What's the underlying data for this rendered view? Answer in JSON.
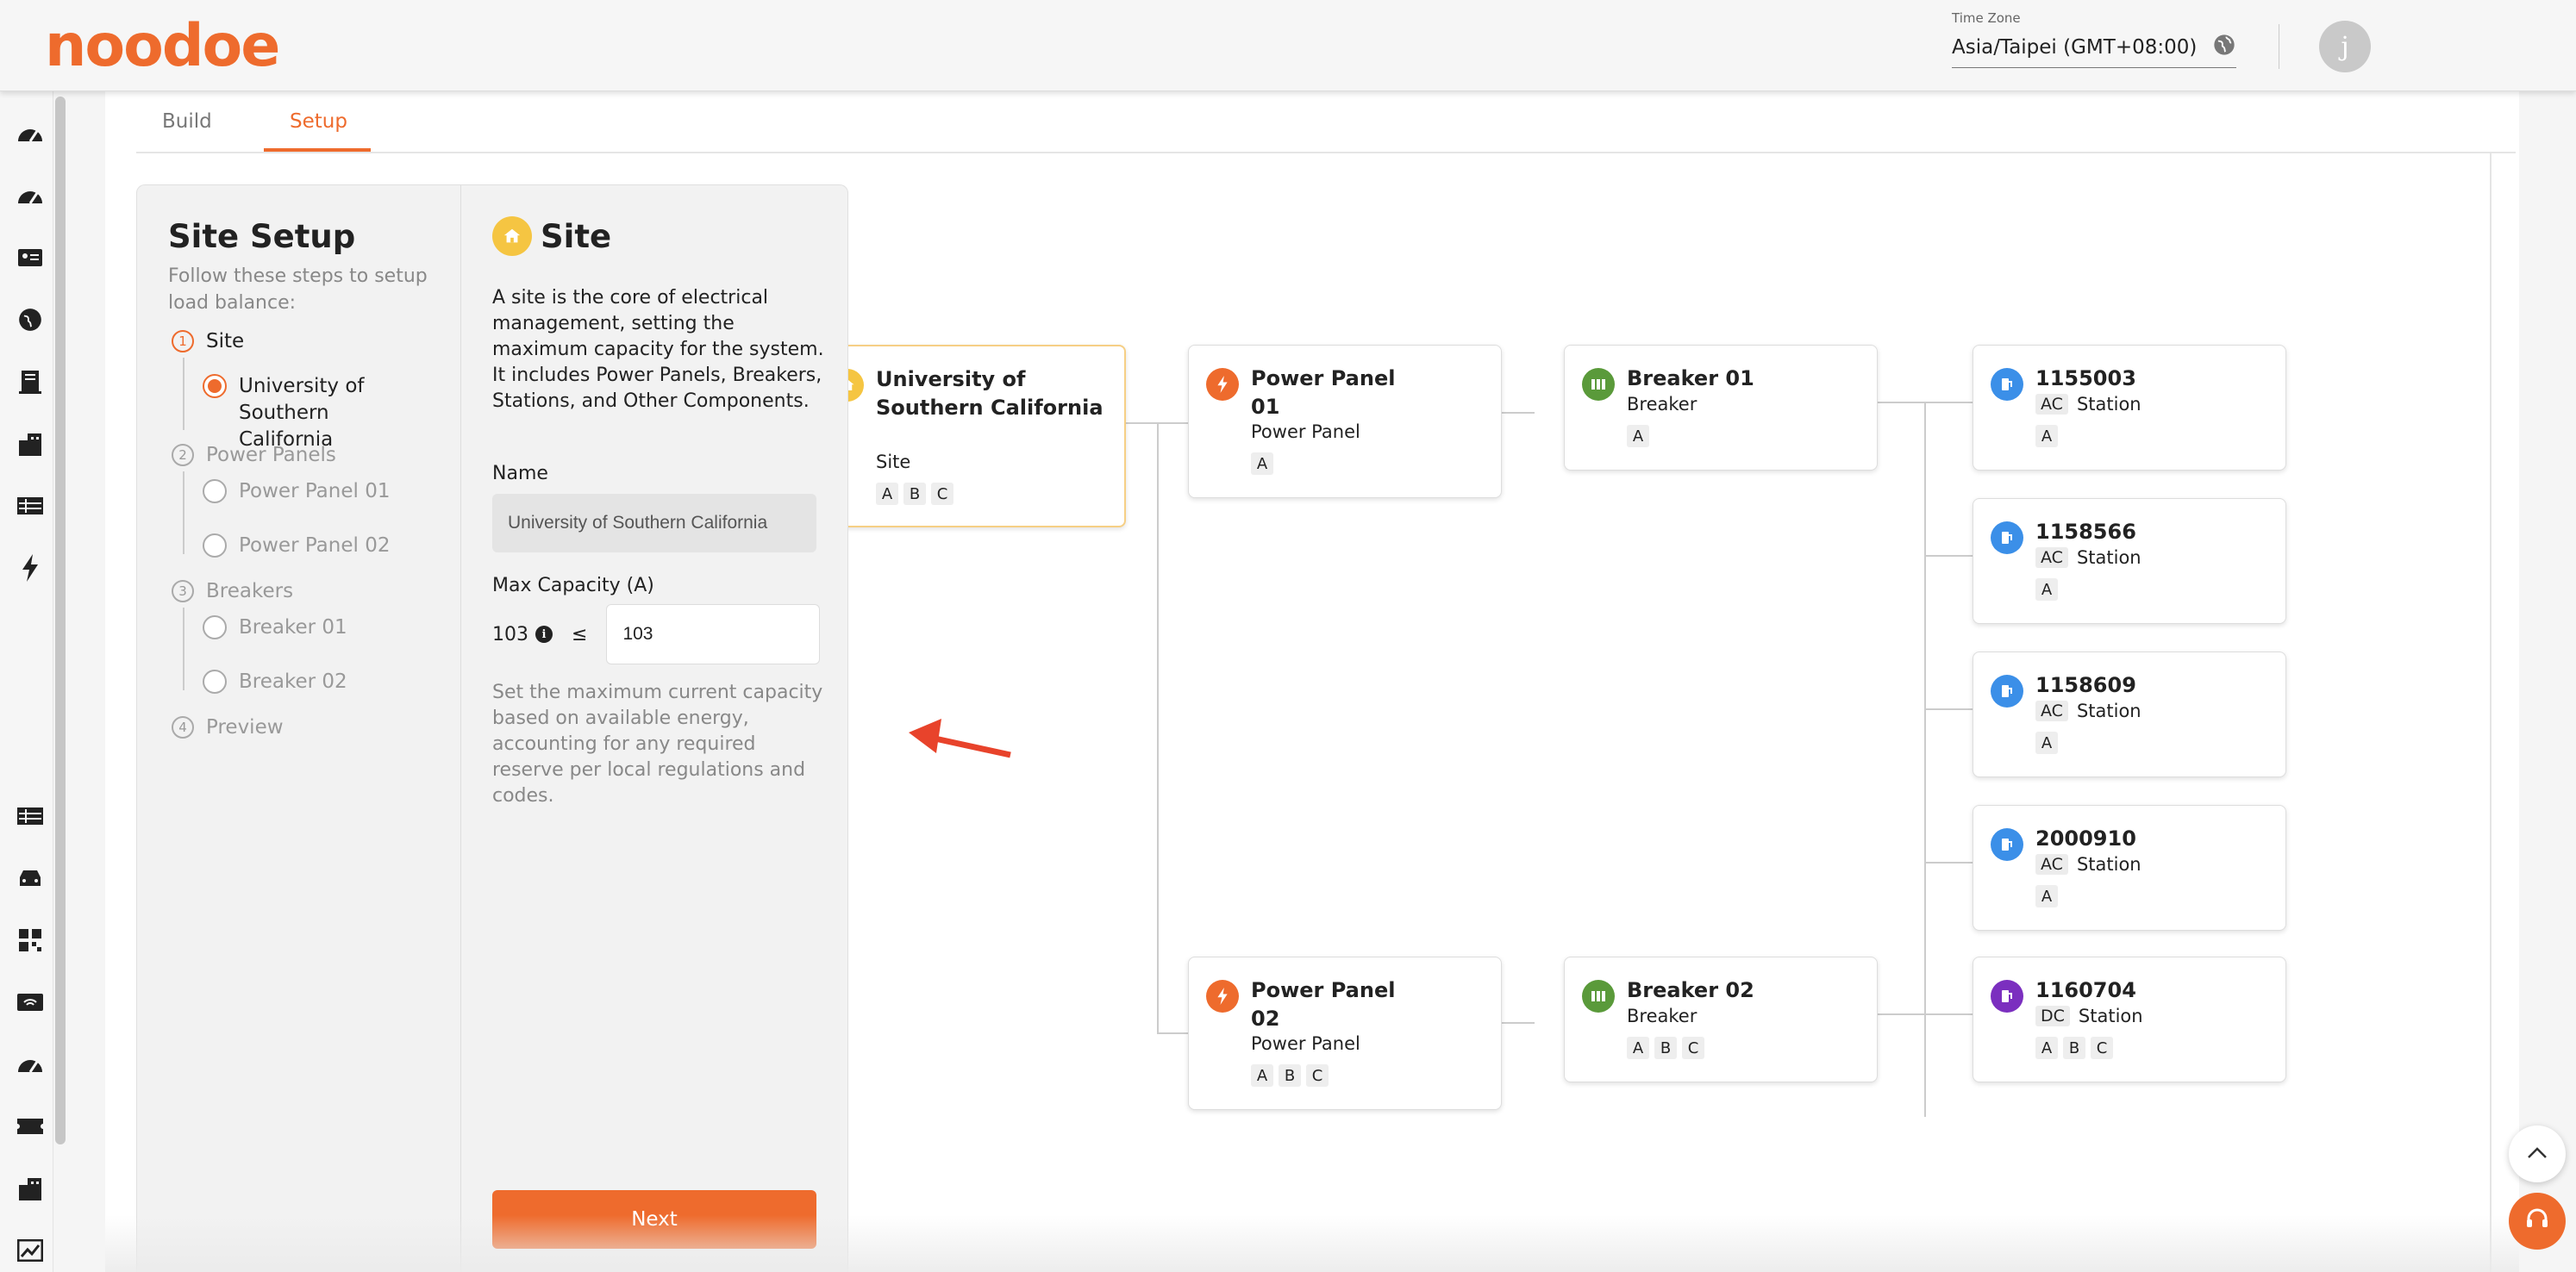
{
  "header": {
    "logo_text": "noodoe",
    "timezone_label": "Time Zone",
    "timezone_value": "Asia/Taipei (GMT+08:00)",
    "avatar_initial": "j"
  },
  "sidebar": {
    "icons": [
      "dashboard-icon",
      "dashboard-icon",
      "id-card-icon",
      "globe-icon",
      "building-icon",
      "city-icon",
      "table-icon",
      "bolt-icon",
      "list-icon",
      "car-icon",
      "apps-icon",
      "wifi-icon",
      "dashboard-icon",
      "ticket-icon",
      "city-icon",
      "chart-icon"
    ]
  },
  "tabs": [
    {
      "label": "Build",
      "active": false
    },
    {
      "label": "Setup",
      "active": true
    }
  ],
  "steps_panel": {
    "title": "Site Setup",
    "subtitle": "Follow these steps to setup load balance:",
    "steps": [
      {
        "num": "1",
        "label": "Site"
      },
      {
        "num": "2",
        "label": "Power Panels"
      },
      {
        "num": "3",
        "label": "Breakers"
      },
      {
        "num": "4",
        "label": "Preview"
      }
    ],
    "site_items": [
      "University of Southern California"
    ],
    "panel_items": [
      "Power Panel 01",
      "Power Panel 02"
    ],
    "breaker_items": [
      "Breaker 01",
      "Breaker 02"
    ]
  },
  "form": {
    "title": "Site",
    "description": "A site is the core of electrical management, setting the maximum capacity for the system. It includes Power Panels, Breakers, Stations, and Other Components.",
    "name_label": "Name",
    "name_value": "University of Southern California",
    "max_label": "Max Capacity (A)",
    "max_reference": "103",
    "le_symbol": "≤",
    "max_value": "103",
    "help": "Set the maximum current capacity based on available energy, accounting for any required reserve per local regulations and codes.",
    "next_label": "Next"
  },
  "tree": {
    "site": {
      "title": "University of Southern California",
      "type": "Site",
      "phases": [
        "A",
        "B",
        "C"
      ]
    },
    "panels": [
      {
        "title": "Power Panel 01",
        "type": "Power Panel",
        "phases": [
          "A"
        ]
      },
      {
        "title": "Power Panel 02",
        "type": "Power Panel",
        "phases": [
          "A",
          "B",
          "C"
        ]
      }
    ],
    "breakers": [
      {
        "title": "Breaker 01",
        "type": "Breaker",
        "phases": [
          "A"
        ]
      },
      {
        "title": "Breaker 02",
        "type": "Breaker",
        "phases": [
          "A",
          "B",
          "C"
        ]
      }
    ],
    "stations": [
      {
        "title": "1155003",
        "current": "AC",
        "type": "Station",
        "phases": [
          "A"
        ]
      },
      {
        "title": "1158566",
        "current": "AC",
        "type": "Station",
        "phases": [
          "A"
        ]
      },
      {
        "title": "1158609",
        "current": "AC",
        "type": "Station",
        "phases": [
          "A"
        ]
      },
      {
        "title": "2000910",
        "current": "AC",
        "type": "Station",
        "phases": [
          "A"
        ]
      },
      {
        "title": "1160704",
        "current": "DC",
        "type": "Station",
        "phases": [
          "A",
          "B",
          "C"
        ]
      }
    ]
  },
  "colors": {
    "accent": "#ee6b2d",
    "site": "#f5c542",
    "panel": "#ee6b2d",
    "breaker": "#5a9a3a",
    "ac_station": "#3b8fe8",
    "dc_station": "#7b2fbf"
  }
}
